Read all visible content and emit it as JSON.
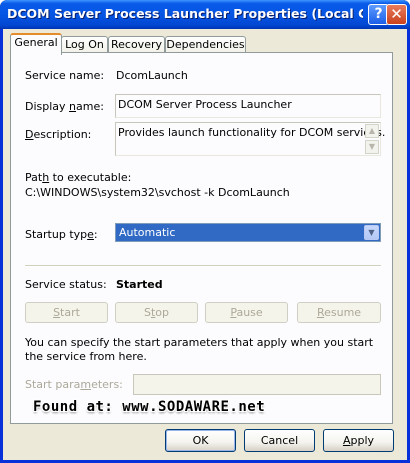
{
  "window": {
    "title": "DCOM Server Process Launcher Properties (Local Comp...",
    "help_glyph": "?",
    "close_glyph": "✕"
  },
  "tabs": [
    {
      "label": "General",
      "active": true
    },
    {
      "label": "Log On",
      "active": false
    },
    {
      "label": "Recovery",
      "active": false
    },
    {
      "label": "Dependencies",
      "active": false
    }
  ],
  "general": {
    "service_name_label": "Service name:",
    "service_name_value": "DcomLaunch",
    "display_name_label_pre": "Display ",
    "display_name_label_ul": "n",
    "display_name_label_post": "ame:",
    "display_name_value": "DCOM Server Process Launcher",
    "description_label_ul": "D",
    "description_label_post": "escription:",
    "description_value": "Provides launch functionality for DCOM services.",
    "path_label_pre": "Pat",
    "path_label_ul": "h",
    "path_label_post": " to executable:",
    "path_value": "C:\\WINDOWS\\system32\\svchost -k DcomLaunch",
    "startup_type_label_pre": "Startup typ",
    "startup_type_label_ul": "e",
    "startup_type_label_post": ":",
    "startup_type_value": "Automatic",
    "service_status_label": "Service status:",
    "service_status_value": "Started",
    "buttons": {
      "start_ul": "S",
      "start_post": "tart",
      "stop_pre": "S",
      "stop_ul": "t",
      "stop_post": "op",
      "pause_ul": "P",
      "pause_post": "ause",
      "resume_ul": "R",
      "resume_post": "esume"
    },
    "hint": "You can specify the start parameters that apply when you start the service from here.",
    "start_params_label_pre": "Start para",
    "start_params_label_ul": "m",
    "start_params_label_post": "eters:",
    "start_params_value": ""
  },
  "watermark": "Found at: www.SODAWARE.net",
  "dialog_buttons": {
    "ok": "OK",
    "cancel": "Cancel",
    "apply_ul": "A",
    "apply_post": "pply"
  }
}
